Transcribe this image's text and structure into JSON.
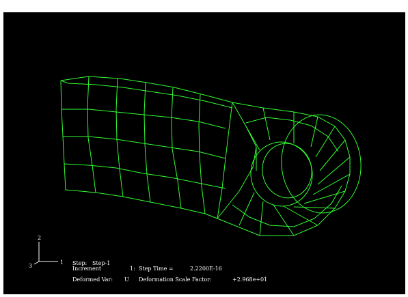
{
  "colors": {
    "background": "#000000",
    "mesh": "#33ff33",
    "text": "#ffffff",
    "triad": "#ffffff"
  },
  "triad": {
    "axis_y": "2",
    "axis_x": "1",
    "axis_z": "3"
  },
  "status": {
    "step_label": "Step:",
    "step_value": "Step-1",
    "increment_label": "Increment",
    "increment_value": "1:",
    "step_time_label": "Step Time =",
    "step_time_value": "2.2200E-16",
    "deformed_var_label": "Deformed Var:",
    "deformed_var_value": "U",
    "scale_factor_label": "Deformation Scale Factor:",
    "scale_factor_value": "+2.968e+01"
  }
}
